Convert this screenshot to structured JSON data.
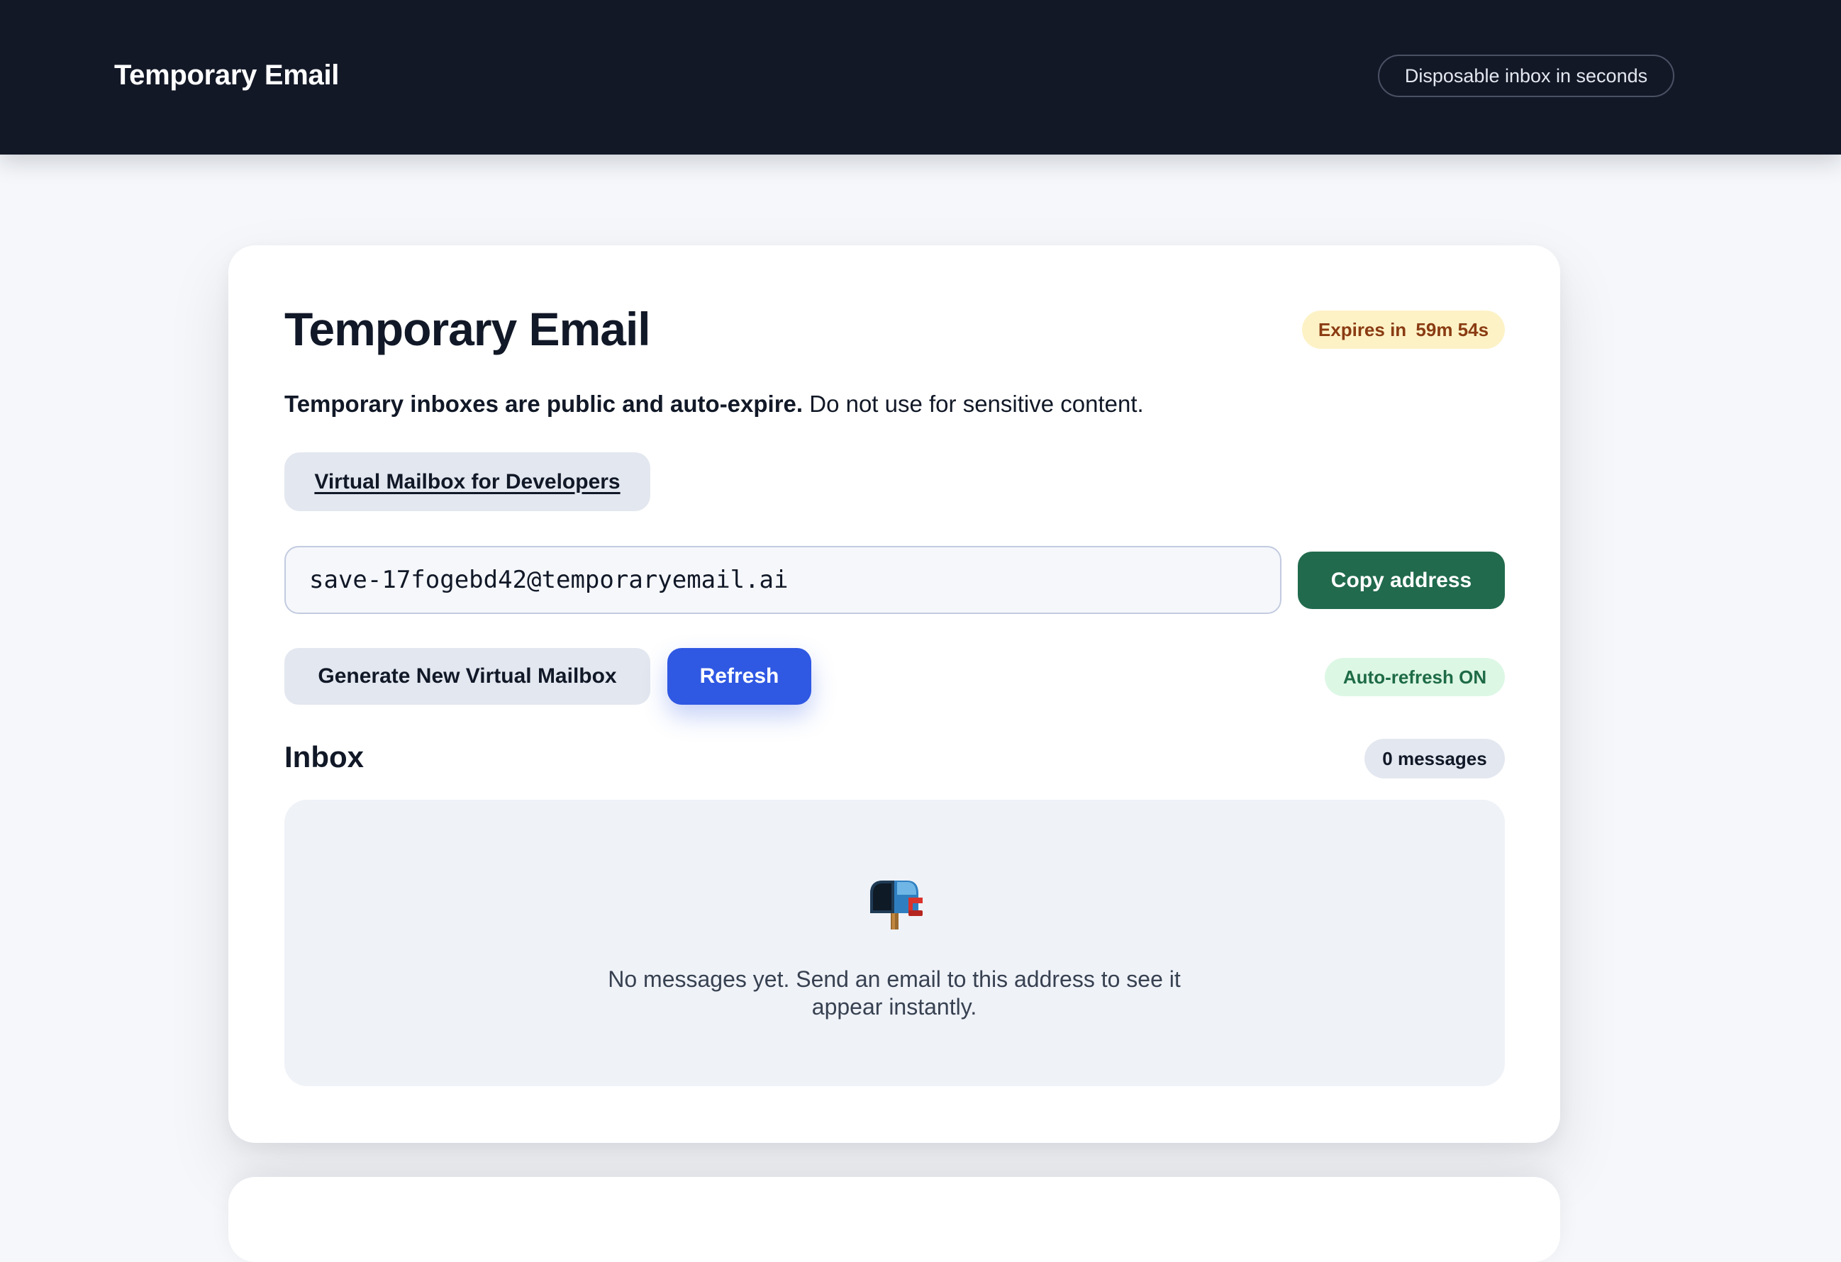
{
  "header": {
    "brand": "Temporary Email",
    "tagline": "Disposable inbox in seconds"
  },
  "card": {
    "title": "Temporary Email",
    "expires": {
      "label": "Expires in",
      "time": "59m 54s"
    },
    "notice": {
      "bold": "Temporary inboxes are public and auto-expire.",
      "rest": " Do not use for sensitive content."
    },
    "dev_link_label": "Virtual Mailbox for Developers",
    "address": "save-17fogebd42@temporaryemail.ai",
    "copy_label": "Copy address",
    "generate_label": "Generate New Virtual Mailbox",
    "refresh_label": "Refresh",
    "autorefresh_status": "Auto-refresh ON"
  },
  "inbox": {
    "title": "Inbox",
    "count": "0 messages",
    "empty_icon": "mailbox-icon",
    "empty_message": "No messages yet. Send an email to this address to see it appear instantly."
  },
  "colors": {
    "header_bg": "#131827",
    "primary": "#2f58e3",
    "copy_button": "#216a4d",
    "expires_bg": "#fdf2c6",
    "expires_text": "#8a3b12",
    "autorefresh_bg": "#ddf7e5",
    "autorefresh_text": "#1e6b46"
  }
}
